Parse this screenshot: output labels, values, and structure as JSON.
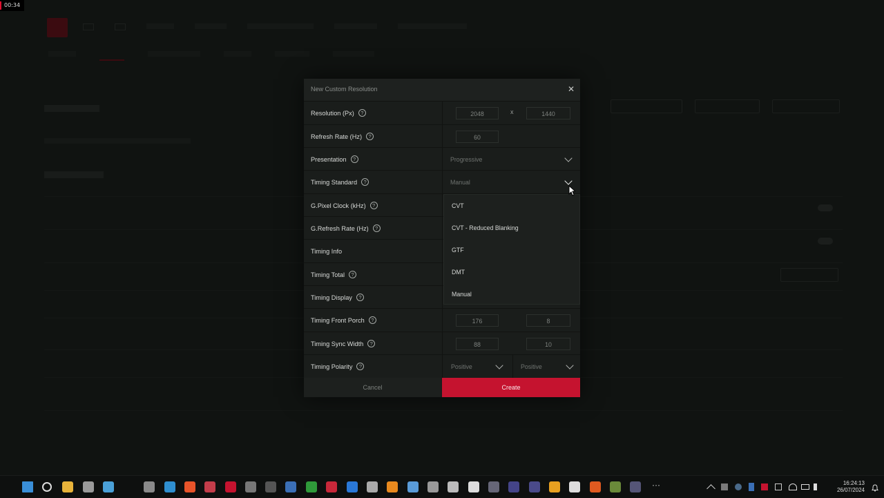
{
  "recording": {
    "timer": "00:34"
  },
  "dialog": {
    "title": "New Custom Resolution",
    "close_label": "✕",
    "rows": {
      "resolution": {
        "label": "Resolution (Px)",
        "width": "2048",
        "separator": "x",
        "height": "1440"
      },
      "refresh_rate": {
        "label": "Refresh Rate (Hz)",
        "value": "60"
      },
      "presentation": {
        "label": "Presentation",
        "value": "Progressive"
      },
      "timing_standard": {
        "label": "Timing Standard",
        "value": "Manual"
      },
      "pixel_clock": {
        "label": "G.Pixel Clock (kHz)"
      },
      "g_refresh_rate": {
        "label": "G.Refresh Rate (Hz)"
      },
      "timing_info": {
        "label": "Timing Info"
      },
      "timing_total": {
        "label": "Timing Total"
      },
      "timing_display": {
        "label": "Timing Display"
      },
      "front_porch": {
        "label": "Timing Front Porch",
        "h": "176",
        "v": "8"
      },
      "sync_width": {
        "label": "Timing Sync Width",
        "h": "88",
        "v": "10"
      },
      "polarity": {
        "label": "Timing Polarity",
        "h": "Positive",
        "v": "Positive"
      }
    },
    "help_glyph": "?",
    "cancel_label": "Cancel",
    "create_label": "Create"
  },
  "timing_dropdown": {
    "options": [
      "CVT",
      "CVT - Reduced Blanking",
      "GTF",
      "DMT",
      "Manual"
    ]
  },
  "taskbar": {
    "time": "16:24:13",
    "date": "26/07/2024",
    "icons": [
      "windows-start-icon",
      "search-icon",
      "file-explorer-icon",
      "terminal-icon",
      "photos-icon",
      "settings-icon",
      "edge-icon",
      "brave-icon",
      "app-icon",
      "amd-software-icon",
      "epic-games-icon",
      "obs-icon",
      "steam-icon",
      "xbox-icon",
      "autodesk-icon",
      "app-store-icon",
      "github-icon",
      "blender-icon",
      "app-icon-2",
      "spider-icon",
      "app-icon-3",
      "notepad-icon",
      "app-icon-4",
      "app-icon-5",
      "app-icon-6",
      "capcut-icon",
      "app-icon-7",
      "vectorworks-icon",
      "app-icon-8",
      "app-icon-9",
      "more-icon"
    ]
  },
  "colors": {
    "accent": "#c5132f",
    "dialog_bg": "#1a1d1b",
    "backdrop": "#101311"
  }
}
